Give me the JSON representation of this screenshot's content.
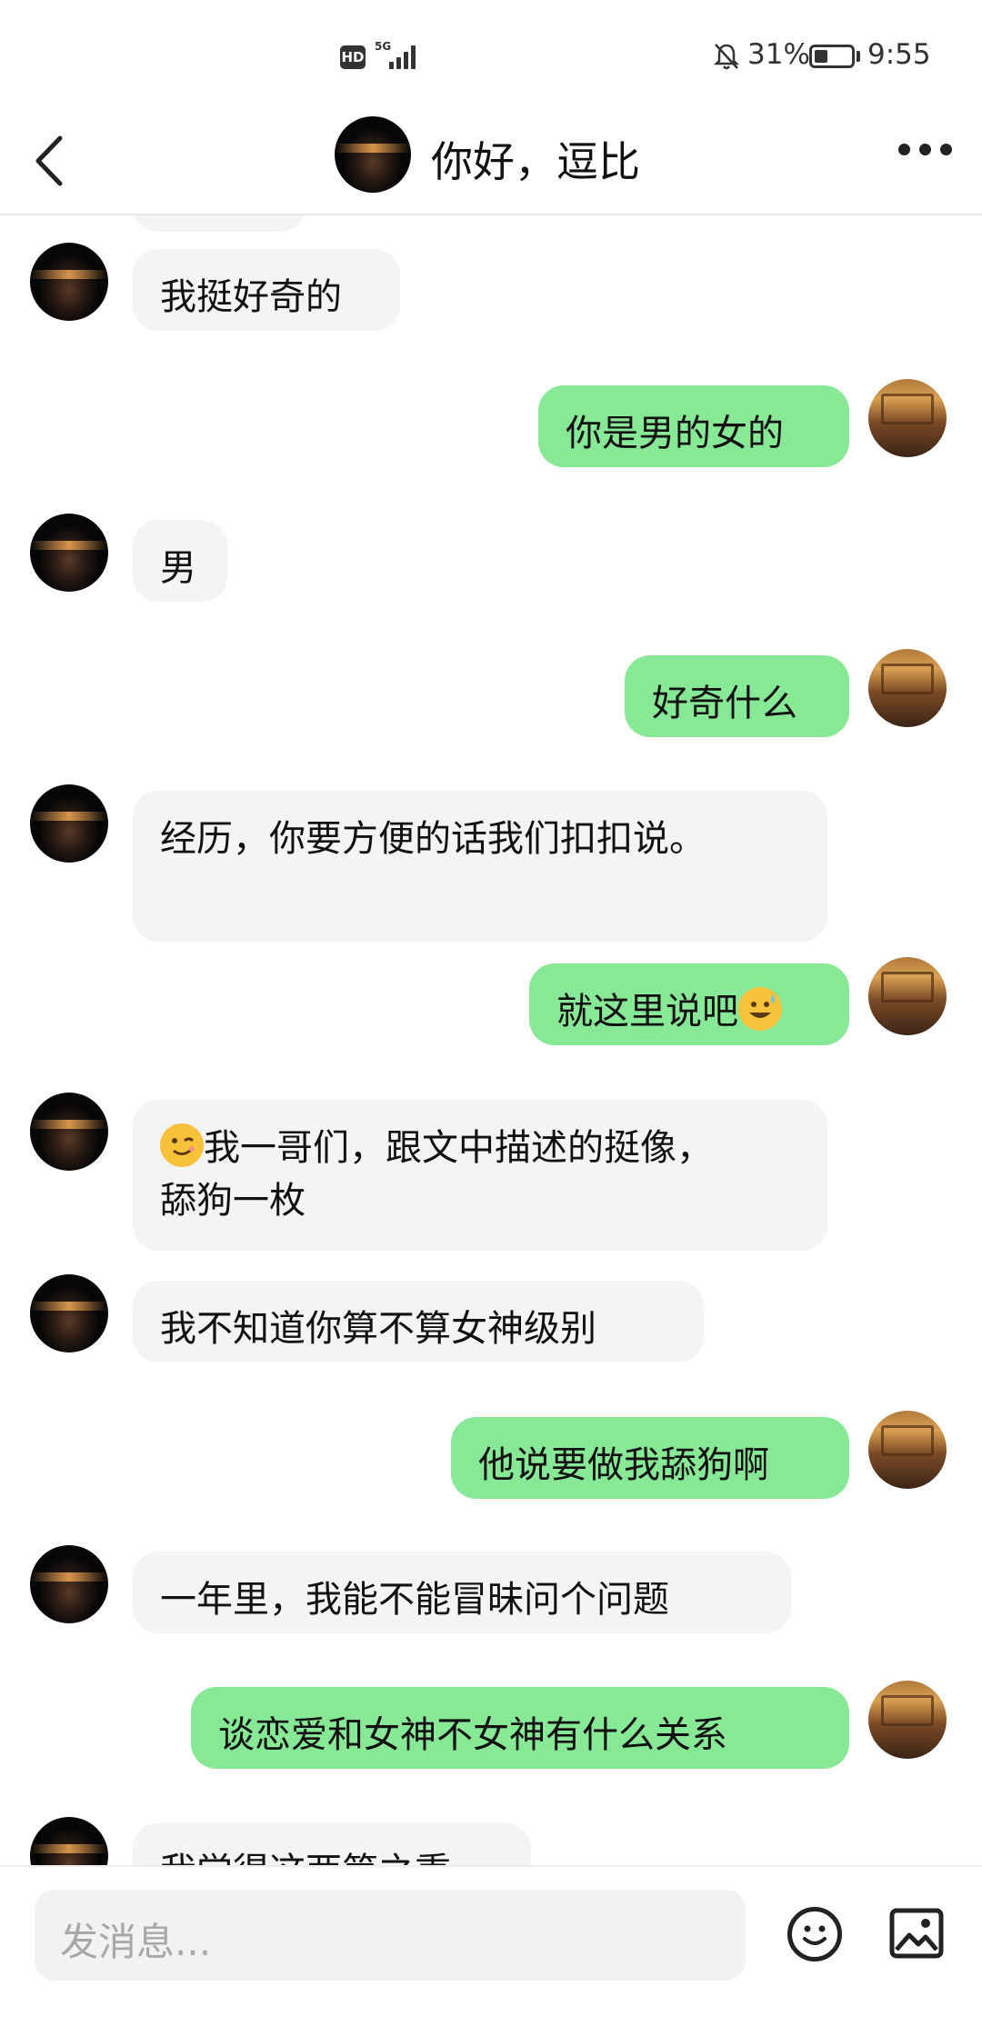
{
  "status_bar": {
    "hd_badge": "HD",
    "network": "5G",
    "signal_bars": 4,
    "battery_percent": "31%",
    "battery_level": 0.31,
    "time": "9:55"
  },
  "header": {
    "title": "你好，逗比",
    "back_icon": "chevron-left-icon",
    "more_icon": "more-horizontal-icon"
  },
  "messages": [
    {
      "side": "in",
      "text": "我挺好奇的"
    },
    {
      "side": "out",
      "text": "你是男的女的"
    },
    {
      "side": "in",
      "text": "男"
    },
    {
      "side": "out",
      "text": "好奇什么"
    },
    {
      "side": "in",
      "text": "经历，你要方便的话我们扣扣说。"
    },
    {
      "side": "out",
      "text": "就这里说吧",
      "emoji_after": "sweat-smile-emoji"
    },
    {
      "side": "in",
      "emoji_before": "wink-emoji",
      "text": "我一哥们，跟文中描述的挺像，舔狗一枚"
    },
    {
      "side": "in",
      "text": "我不知道你算不算女神级别"
    },
    {
      "side": "out",
      "text": "他说要做我舔狗啊"
    },
    {
      "side": "in",
      "text": "一年里，我能不能冒昧问个问题"
    },
    {
      "side": "out",
      "text": "谈恋爱和女神不女神有什么关系"
    },
    {
      "side": "in",
      "text": "我觉得这两第之重"
    }
  ],
  "input_bar": {
    "placeholder": "发消息...",
    "emoji_icon": "smiley-icon",
    "image_icon": "image-icon"
  },
  "colors": {
    "outgoing_bubble": "#87e896",
    "incoming_bubble": "#f4f4f4"
  }
}
